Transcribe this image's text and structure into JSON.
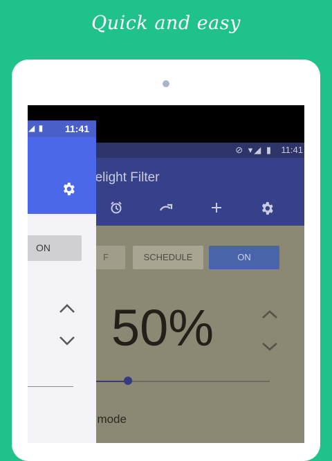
{
  "tagline": "Quick and easy",
  "bg_app": {
    "status_time": "11:41",
    "status_icons": "⊘ ▾◢ ▮",
    "title": "uelight Filter",
    "modes": {
      "off": "F",
      "schedule": "SCHEDULE",
      "on": "ON"
    },
    "percent": "50%",
    "slider_value_percent": 50,
    "mode_label": "t mode"
  },
  "fg_app": {
    "status_time": "11:41",
    "status_icons": "▾◢ ▮",
    "on_button": "ON"
  },
  "colors": {
    "background": "#20c28c",
    "fg_toolbar": "#4b68e8",
    "bg_toolbar": "#36418a"
  },
  "icons": [
    "alarm-icon",
    "redo-icon",
    "plus-icon",
    "gear-icon",
    "chevron-up-icon",
    "chevron-down-icon"
  ]
}
